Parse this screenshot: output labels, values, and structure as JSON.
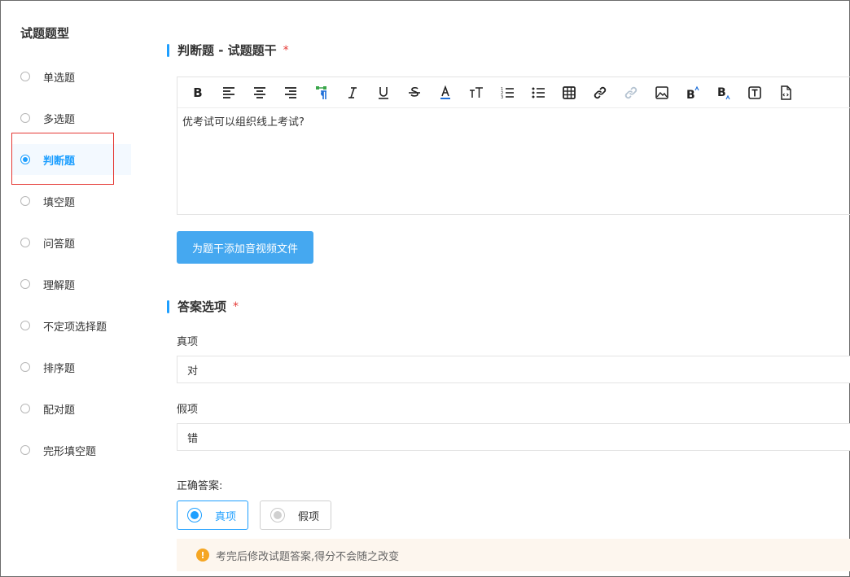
{
  "sidebar": {
    "title": "试题题型",
    "items": [
      {
        "label": "单选题"
      },
      {
        "label": "多选题"
      },
      {
        "label": "判断题"
      },
      {
        "label": "填空题"
      },
      {
        "label": "问答题"
      },
      {
        "label": "理解题"
      },
      {
        "label": "不定项选择题"
      },
      {
        "label": "排序题"
      },
      {
        "label": "配对题"
      },
      {
        "label": "完形填空题"
      }
    ],
    "active_index": 2
  },
  "stem_section": {
    "title": "判断题 - 试题题干",
    "required_mark": "*"
  },
  "editor": {
    "content": "优考试可以组织线上考试?",
    "toolbar": [
      "bold-icon",
      "align-left-icon",
      "align-center-icon",
      "align-right-icon",
      "clear-format-icon",
      "italic-icon",
      "underline-icon",
      "strikethrough-icon",
      "font-color-icon",
      "font-size-icon",
      "ordered-list-icon",
      "unordered-list-icon",
      "table-icon",
      "link-icon",
      "unlink-icon",
      "image-icon",
      "superscript-icon",
      "subscript-icon",
      "text-box-icon",
      "code-file-icon"
    ]
  },
  "upload_button": {
    "label": "为题干添加音视频文件"
  },
  "answer_section": {
    "title": "答案选项",
    "required_mark": "*"
  },
  "true_option": {
    "label": "真项",
    "value": "对"
  },
  "false_option": {
    "label": "假项",
    "value": "错"
  },
  "correct_answer": {
    "label": "正确答案:",
    "options": [
      {
        "label": "真项",
        "selected": true
      },
      {
        "label": "假项",
        "selected": false
      }
    ]
  },
  "notice": {
    "message": "考完后修改试题答案,得分不会随之改变"
  },
  "colors": {
    "accent": "#1e9fff",
    "button": "#45a8f0",
    "required": "#e53935",
    "warning": "#f5a623"
  }
}
